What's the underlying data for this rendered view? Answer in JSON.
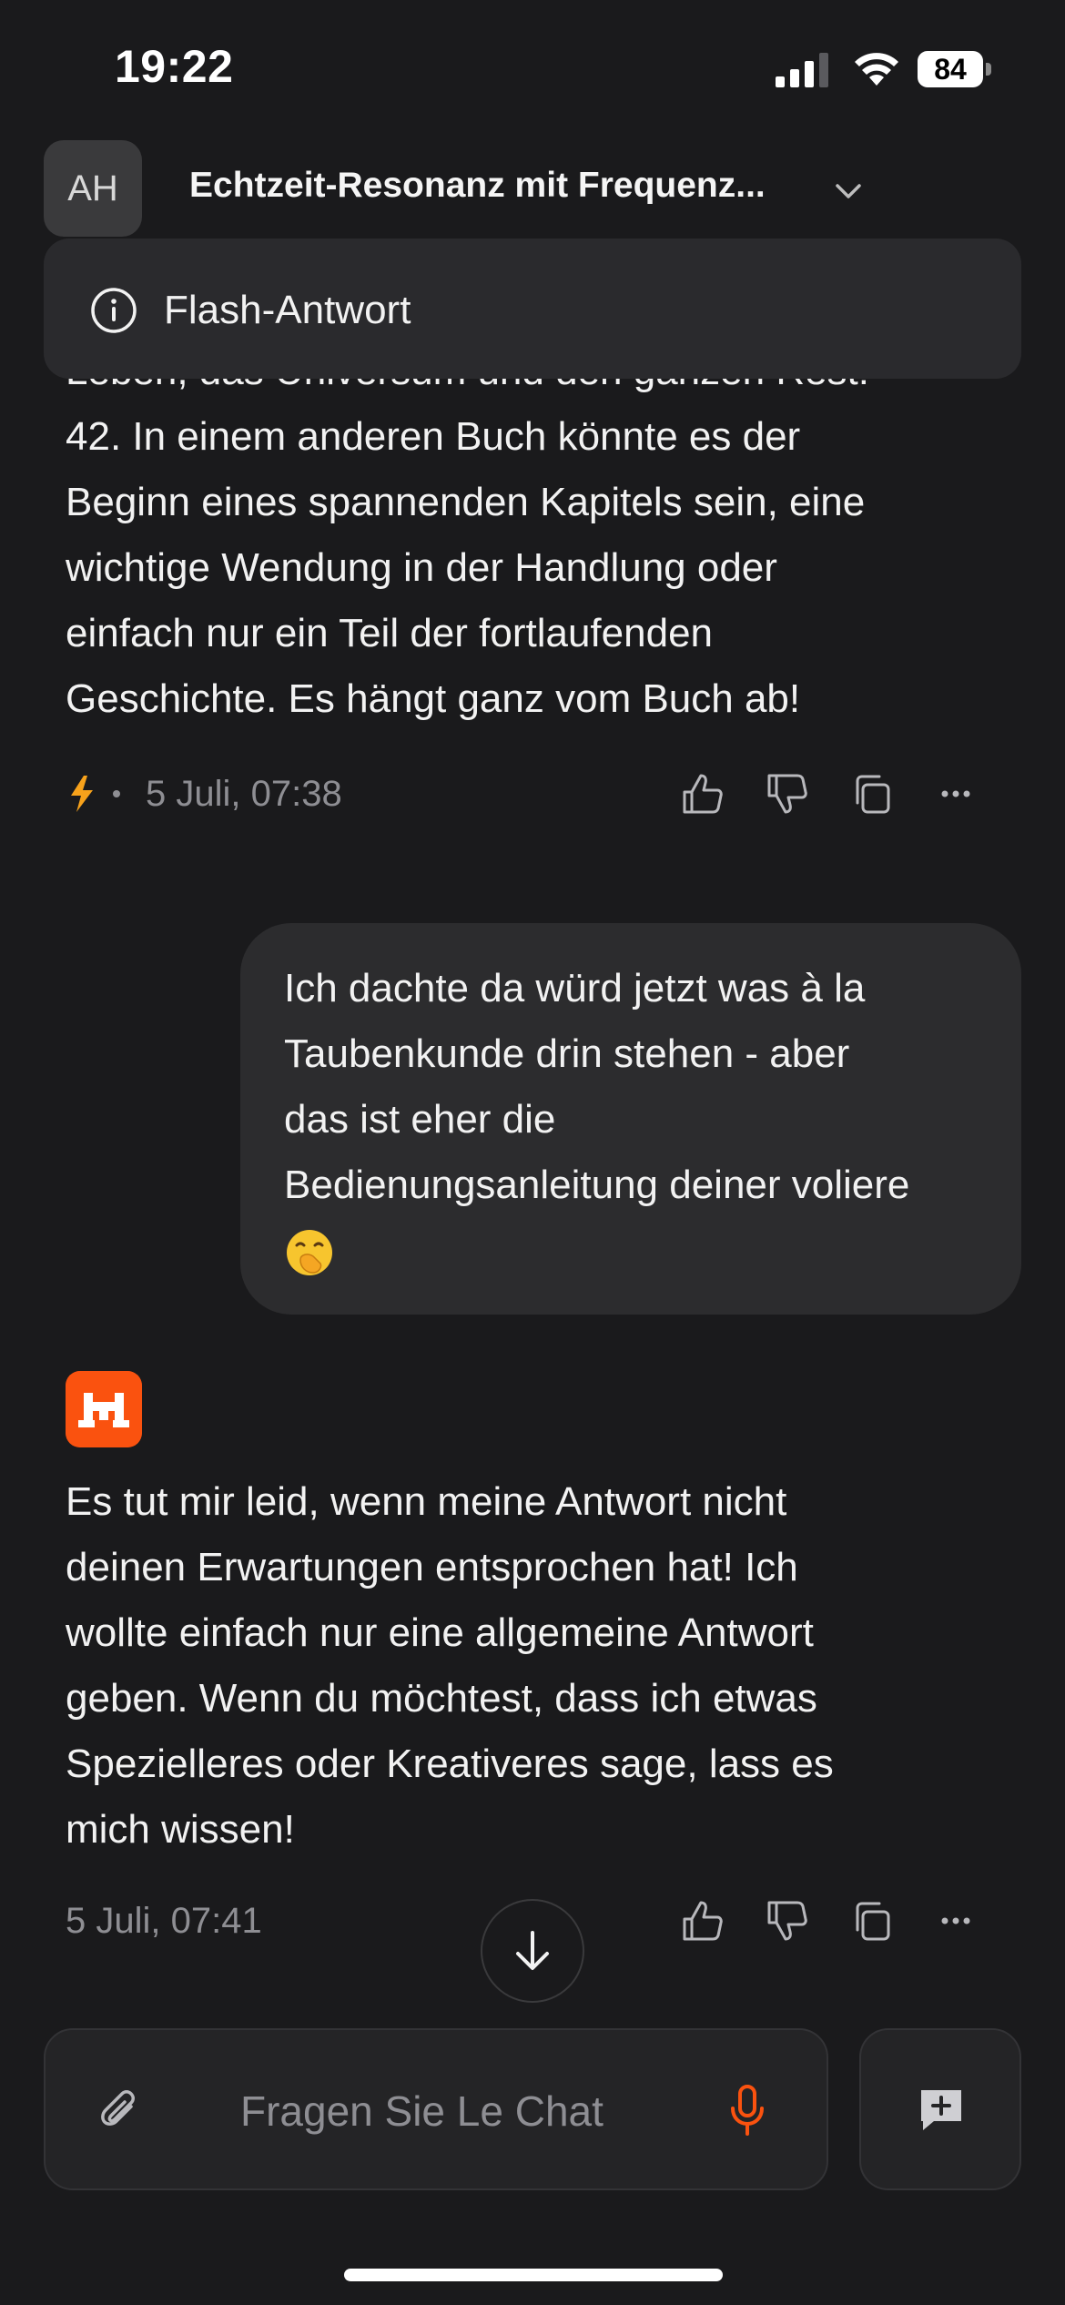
{
  "status_bar": {
    "time": "19:22",
    "battery": "84"
  },
  "header": {
    "avatar_initials": "AH",
    "title": "Echtzeit-Resonanz mit Frequenz...",
    "info_banner": "Flash-Antwort"
  },
  "messages": [
    {
      "role": "assistant",
      "lines": [
        "Leben, das Universum und den ganzen Rest:",
        "42. In einem anderen Buch könnte es der",
        "Beginn eines spannenden Kapitels sein, eine",
        "wichtige Wendung in der Handlung oder",
        "einfach nur ein Teil der fortlaufenden",
        "Geschichte. Es hängt ganz vom Buch ab!"
      ],
      "timestamp": "5 Juli, 07:38"
    },
    {
      "role": "user",
      "lines": [
        "Ich dachte da würd jetzt was à la",
        "Taubenkunde drin stehen - aber",
        "das ist eher die",
        "Bedienungsanleitung deiner voliere"
      ],
      "emoji": "hand-over-mouth-emoji"
    },
    {
      "role": "assistant",
      "lines": [
        "Es tut mir leid, wenn meine Antwort nicht",
        "deinen Erwartungen entsprochen hat! Ich",
        "wollte einfach nur eine allgemeine Antwort",
        "geben. Wenn du möchtest, dass ich etwas",
        "Spezielleres oder Kreativeres sage, lass es",
        "mich wissen!"
      ],
      "timestamp": "5 Juli, 07:41"
    }
  ],
  "composer": {
    "placeholder": "Fragen Sie Le Chat"
  },
  "colors": {
    "background": "#1a1a1c",
    "accent": "#fa520f",
    "bubble": "#2c2c2e",
    "muted": "#8e8e93"
  }
}
